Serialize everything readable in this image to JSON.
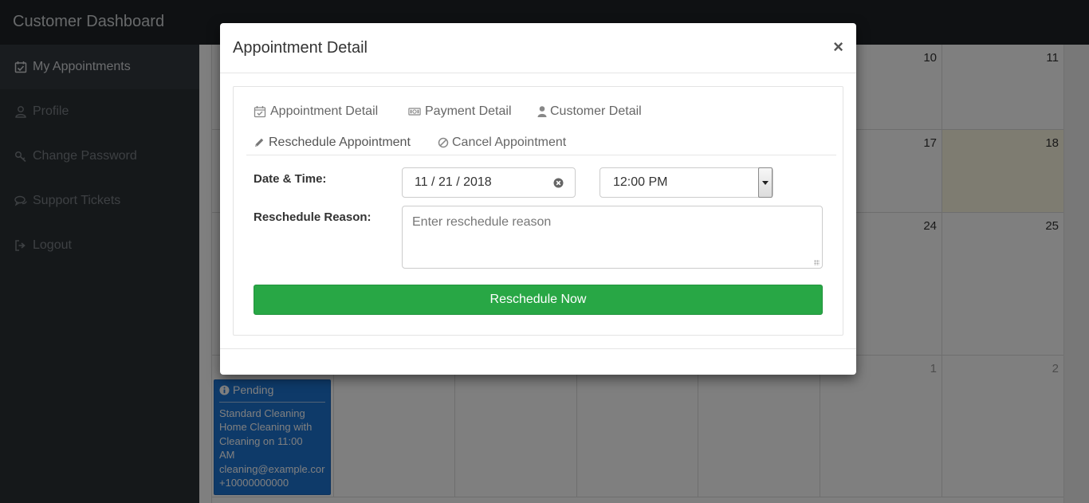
{
  "app": {
    "title": "Customer Dashboard"
  },
  "sidebar": {
    "items": [
      {
        "label": "My Appointments",
        "icon": "calendar-check-icon",
        "active": true
      },
      {
        "label": "Profile",
        "icon": "user-icon",
        "active": false
      },
      {
        "label": "Change Password",
        "icon": "key-icon",
        "active": false
      },
      {
        "label": "Support Tickets",
        "icon": "comments-icon",
        "active": false
      },
      {
        "label": "Logout",
        "icon": "sign-out-icon",
        "active": false
      }
    ]
  },
  "calendar": {
    "days": [
      "10",
      "11",
      "17",
      "18",
      "24",
      "25",
      "1",
      "2"
    ],
    "today": "18",
    "event": {
      "status": "Pending",
      "status_icon": "info-circle-icon",
      "lines": [
        "Standard Cleaning",
        "Home Cleaning with",
        "Cleaning on 11:00",
        "AM",
        "cleaning@example.cor",
        "+10000000000"
      ]
    }
  },
  "modal": {
    "title": "Appointment Detail",
    "close_label": "×",
    "tabs": [
      {
        "label": "Appointment Detail",
        "icon": "calendar-check-icon"
      },
      {
        "label": "Payment Detail",
        "icon": "money-icon"
      },
      {
        "label": "Customer Detail",
        "icon": "user-icon"
      },
      {
        "label": "Reschedule Appointment",
        "icon": "pencil-icon"
      },
      {
        "label": "Cancel Appointment",
        "icon": "ban-icon"
      }
    ],
    "active_tab": "Reschedule Appointment",
    "form": {
      "date_time_label": "Date & Time:",
      "date_value": "11 / 21 / 2018",
      "time_value": "12:00 PM",
      "reason_label": "Reschedule Reason:",
      "reason_placeholder": "Enter reschedule reason",
      "submit_label": "Reschedule Now"
    }
  },
  "colors": {
    "topbar": "#1e2226",
    "sidebar": "#2b3035",
    "event": "#1d74d3",
    "today": "#fcf8e3",
    "primary_button": "#28a745"
  }
}
